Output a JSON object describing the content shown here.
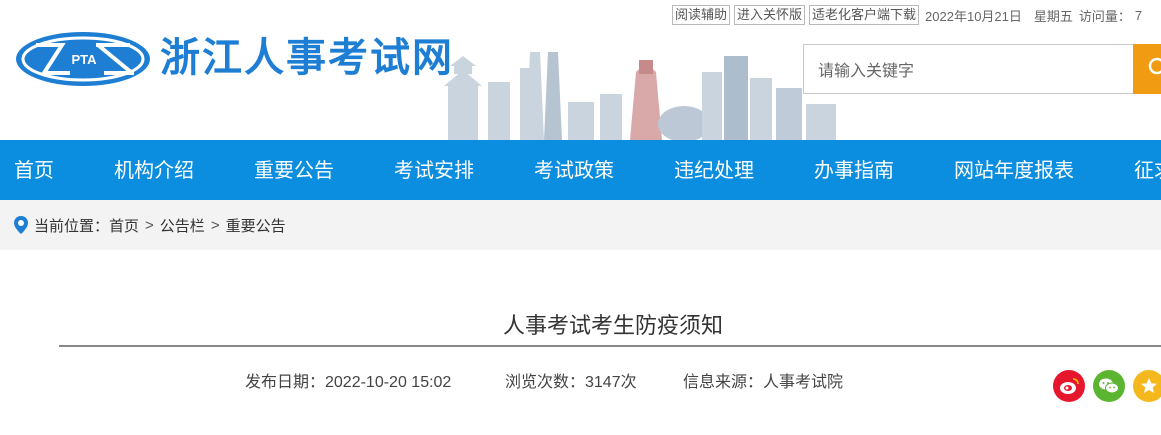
{
  "topbar": {
    "links": [
      "阅读辅助",
      "进入关怀版",
      "适老化客户端下载"
    ],
    "date": "2022年10月21日",
    "weekday": "星期五",
    "visits_label": "访问量：",
    "visits_value": "7"
  },
  "header": {
    "logo_text": "PTA",
    "site_title": "浙江人事考试网"
  },
  "search": {
    "placeholder": "请输入关键字"
  },
  "nav": {
    "items": [
      "首页",
      "机构介绍",
      "重要公告",
      "考试安排",
      "考试政策",
      "违纪处理",
      "办事指南",
      "网站年度报表",
      "征求"
    ]
  },
  "breadcrumb": {
    "prefix": "当前位置：",
    "items": [
      "首页",
      "公告栏",
      "重要公告"
    ],
    "separator": ">"
  },
  "article": {
    "title": "人事考试考生防疫须知",
    "publish_date": "发布日期：2022-10-20 15:02",
    "views": "浏览次数：3147次",
    "source": "信息来源：人事考试院"
  },
  "share": {
    "icons": [
      "weibo-icon",
      "wechat-icon",
      "favorite-icon"
    ],
    "colors": [
      "#e6162d",
      "#5cb531",
      "#f5b81c"
    ]
  },
  "colors": {
    "brand_blue": "#1e7ed4",
    "nav_blue": "#0c8ee0",
    "search_orange": "#f19b13"
  }
}
